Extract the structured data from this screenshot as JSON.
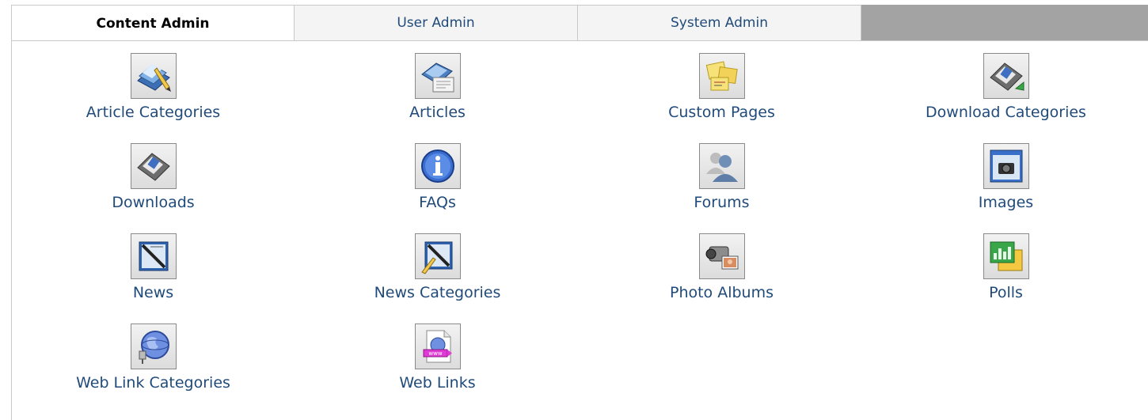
{
  "tabs": [
    {
      "label": "Content Admin",
      "active": true
    },
    {
      "label": "User Admin",
      "active": false
    },
    {
      "label": "System Admin",
      "active": false
    }
  ],
  "items": [
    {
      "label": "Article Categories",
      "icon": "article-categories-icon"
    },
    {
      "label": "Articles",
      "icon": "articles-icon"
    },
    {
      "label": "Custom Pages",
      "icon": "sticky-notes-icon"
    },
    {
      "label": "Download Categories",
      "icon": "download-categories-icon"
    },
    {
      "label": "Downloads",
      "icon": "downloads-icon"
    },
    {
      "label": "FAQs",
      "icon": "info-icon"
    },
    {
      "label": "Forums",
      "icon": "users-icon"
    },
    {
      "label": "Images",
      "icon": "camera-window-icon"
    },
    {
      "label": "News",
      "icon": "news-icon"
    },
    {
      "label": "News Categories",
      "icon": "news-categories-icon"
    },
    {
      "label": "Photo Albums",
      "icon": "camcorder-icon"
    },
    {
      "label": "Polls",
      "icon": "poll-chart-icon"
    },
    {
      "label": "Web Link Categories",
      "icon": "globe-plug-icon"
    },
    {
      "label": "Web Links",
      "icon": "web-document-icon"
    }
  ],
  "colors": {
    "link": "#1f4a7a",
    "tab_filler": "#a3a3a3",
    "border": "#c9c9c9"
  }
}
